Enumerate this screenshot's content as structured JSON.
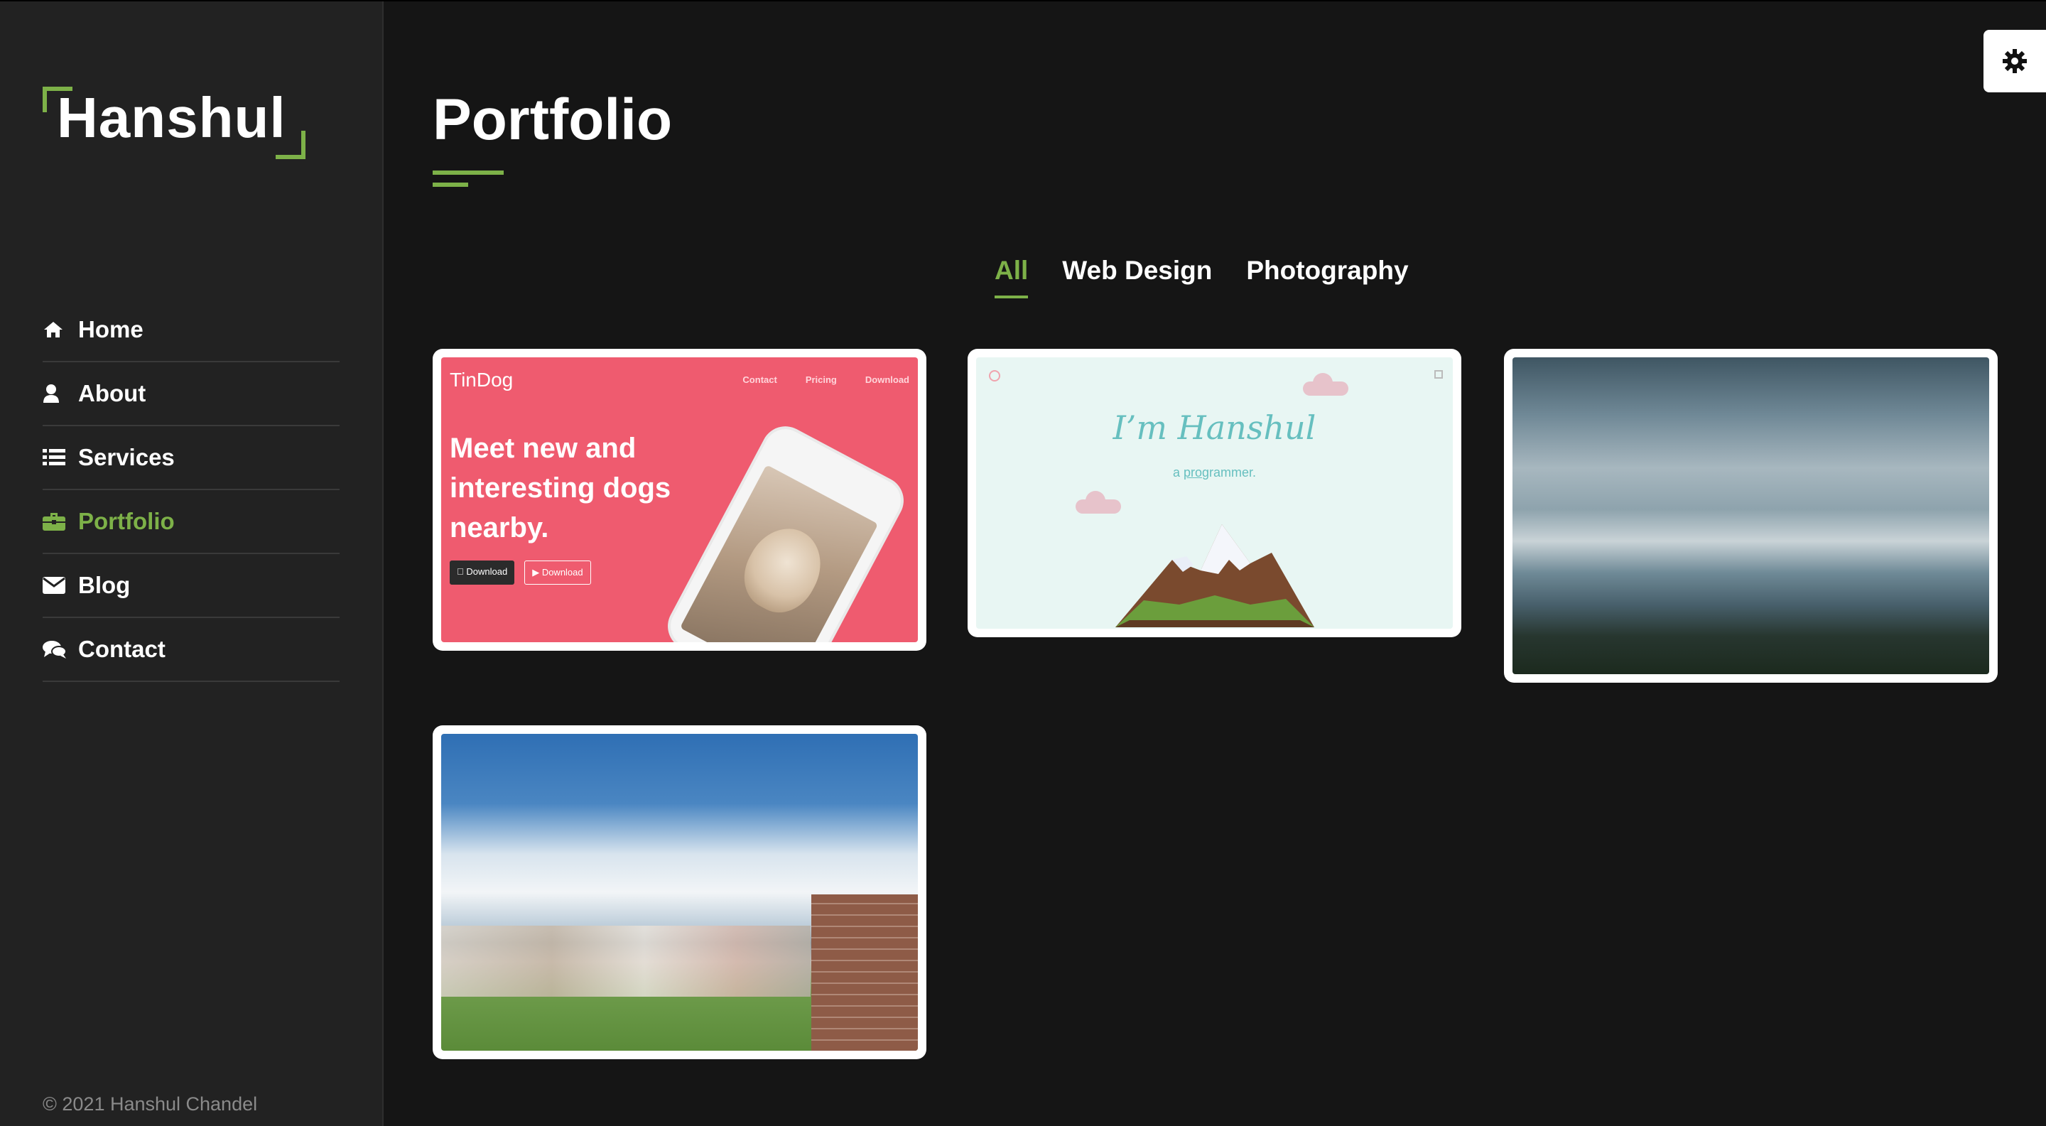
{
  "logo": {
    "text": "Hanshul",
    "accent": "#7db148"
  },
  "nav": [
    {
      "label": "Home",
      "icon": "home-icon",
      "active": false
    },
    {
      "label": "About",
      "icon": "user-icon",
      "active": false
    },
    {
      "label": "Services",
      "icon": "list-icon",
      "active": false
    },
    {
      "label": "Portfolio",
      "icon": "briefcase-icon",
      "active": true
    },
    {
      "label": "Blog",
      "icon": "envelope-icon",
      "active": false
    },
    {
      "label": "Contact",
      "icon": "comments-icon",
      "active": false
    }
  ],
  "footer": {
    "copyright": "© 2021 Hanshul Chandel"
  },
  "main": {
    "title": "Portfolio",
    "filters": [
      {
        "label": "All",
        "active": true
      },
      {
        "label": "Web Design",
        "active": false
      },
      {
        "label": "Photography",
        "active": false
      }
    ]
  },
  "items": {
    "tindog": {
      "brand": "TinDog",
      "nav": [
        "Contact",
        "Pricing",
        "Download"
      ],
      "headline": "Meet new and interesting dogs nearby.",
      "button1": "Download",
      "button2": "Download",
      "color": "#ef5b6f"
    },
    "hanshul": {
      "name": "I’m Hanshul",
      "sub_prefix": "a ",
      "sub_link": "pro",
      "sub_suffix": "grammer.",
      "color": "#e8f6f3"
    }
  },
  "settings": {
    "icon": "gear-icon"
  }
}
